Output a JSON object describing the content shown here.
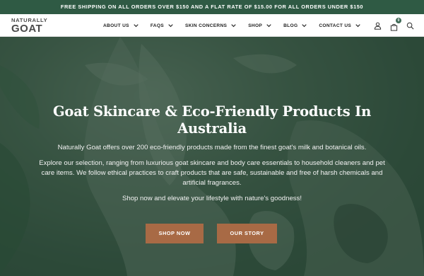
{
  "announcement": "FREE SHIPPING ON ALL ORDERS OVER $150 AND A FLAT RATE OF $15.00 FOR ALL ORDERS UNDER $150",
  "logo": {
    "top": "NATURALLY",
    "main": "GOAT"
  },
  "nav": {
    "items": [
      {
        "label": "ABOUT US"
      },
      {
        "label": "FAQS"
      },
      {
        "label": "SKIN CONCERNS"
      },
      {
        "label": "SHOP"
      },
      {
        "label": "BLOG"
      },
      {
        "label": "CONTACT US"
      }
    ],
    "icons": [
      "user-icon",
      "cart-icon",
      "search-icon"
    ],
    "cart_count": "0"
  },
  "hero": {
    "title": "Goat Skincare & Eco-Friendly Products In Australia",
    "paragraph_1": "Naturally Goat offers over 200 eco-friendly products made from the finest goat's milk and botanical oils.",
    "paragraph_2": "Explore our selection, ranging from luxurious goat skincare and body care essentials to household cleaners and pet care items. We follow ethical practices to craft products that are safe, sustainable and free of harsh chemicals and artificial fragrances.",
    "paragraph_3": "Shop now and elevate your lifestyle with nature's goodness!",
    "shop_now_label": "SHOP NOW",
    "our_story_label": "OUR STORY"
  },
  "colors": {
    "announcement_bg": "#2f5a44",
    "hero_overlay": "#264a37",
    "button_bg": "#a86a45",
    "badge_bg": "#3f6b57"
  }
}
